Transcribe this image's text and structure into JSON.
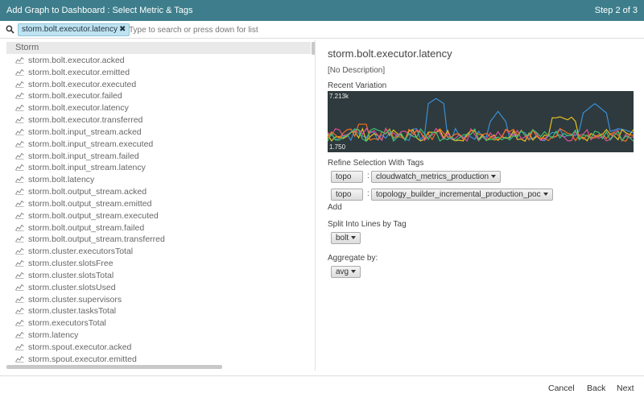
{
  "header": {
    "title": "Add Graph to Dashboard : Select Metric & Tags",
    "step": "Step 2 of 3"
  },
  "search": {
    "chip_label": "storm.bolt.executor.latency",
    "chip_remove": "✖",
    "placeholder": "Type to search or press down for list",
    "icon": "search-icon"
  },
  "metric_list": {
    "header": "Storm",
    "item_icon": "line-chart-icon",
    "items": [
      "storm.bolt.executor.acked",
      "storm.bolt.executor.emitted",
      "storm.bolt.executor.executed",
      "storm.bolt.executor.failed",
      "storm.bolt.executor.latency",
      "storm.bolt.executor.transferred",
      "storm.bolt.input_stream.acked",
      "storm.bolt.input_stream.executed",
      "storm.bolt.input_stream.failed",
      "storm.bolt.input_stream.latency",
      "storm.bolt.latency",
      "storm.bolt.output_stream.acked",
      "storm.bolt.output_stream.emitted",
      "storm.bolt.output_stream.executed",
      "storm.bolt.output_stream.failed",
      "storm.bolt.output_stream.transferred",
      "storm.cluster.executorsTotal",
      "storm.cluster.slotsFree",
      "storm.cluster.slotsTotal",
      "storm.cluster.slotsUsed",
      "storm.cluster.supervisors",
      "storm.cluster.tasksTotal",
      "storm.executorsTotal",
      "storm.latency",
      "storm.spout.executor.acked",
      "storm.spout.executor.emitted"
    ]
  },
  "details": {
    "metric_name": "storm.bolt.executor.latency",
    "description": "[No Description]",
    "recent_variation_label": "Recent Variation",
    "chart_max_label": "7.213k",
    "chart_min_label": "1.750",
    "chart_colors": [
      "#3a8fd8",
      "#e8c020",
      "#e0509a",
      "#f07020",
      "#40c070"
    ],
    "refine_label": "Refine Selection With Tags",
    "tags": [
      {
        "key": "topo",
        "value": "cloudwatch_metrics_production"
      },
      {
        "key": "topo",
        "value": "topology_builder_incremental_production_poc"
      }
    ],
    "add_label": "Add",
    "split_label": "Split Into Lines by Tag",
    "split_value": "bolt",
    "aggregate_label": "Aggregate by:",
    "aggregate_value": "avg"
  },
  "footer": {
    "cancel": "Cancel",
    "back": "Back",
    "next": "Next"
  }
}
